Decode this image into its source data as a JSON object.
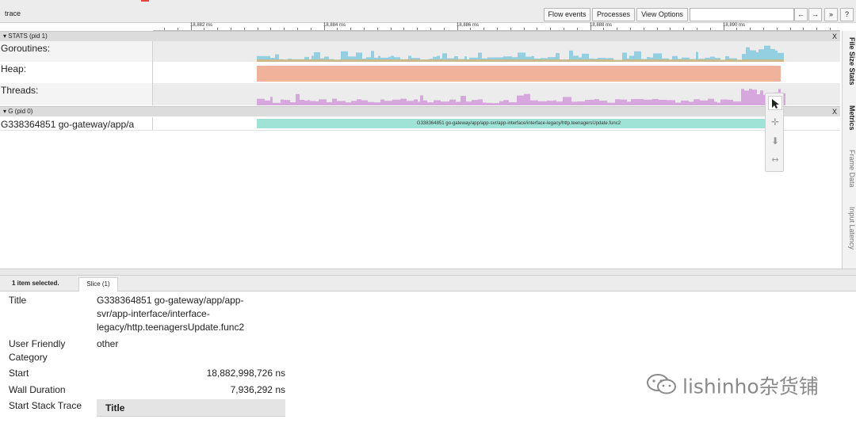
{
  "toolbar": {
    "title": "trace",
    "flow_events": "Flow events",
    "processes": "Processes",
    "view_options": "View Options",
    "search_value": "",
    "prev": "←",
    "next": "→",
    "expand": "»",
    "help": "?"
  },
  "ruler": {
    "labels": [
      "18,882 ms",
      "18,884 ms",
      "18,886 ms",
      "18,888 ms",
      "18,890 ms"
    ]
  },
  "stats_process": {
    "header": "▾ STATS (pid 1)",
    "close": "X",
    "tracks": [
      {
        "label": "Goroutines:"
      },
      {
        "label": "Heap:"
      },
      {
        "label": "Threads:"
      }
    ]
  },
  "g_process": {
    "header": "▾ G (pid 0)",
    "close": "X",
    "thread_label": "G338364851 go-gateway/app/a",
    "slice_title": "G338364851 go-gateway/app/app-svr/app-interface/interface-legacy/http.teenagersUpdate.func2"
  },
  "right_tabs": [
    "File Size Stats",
    "Metrics",
    "Frame Data",
    "Input Latency"
  ],
  "tools": {
    "select": "select-tool",
    "pan": "pan-tool",
    "zoom": "zoom-tool",
    "timing": "timing-tool"
  },
  "panel": {
    "selection_info": "1 item selected.",
    "tab": "Slice (1)",
    "rows": {
      "title_label": "Title",
      "title_value_1": "G338364851 go-gateway/app/app-",
      "title_value_2": "svr/app-interface/interface-",
      "title_value_3": "legacy/http.teenagersUpdate.func2",
      "category_label_1": "User Friendly",
      "category_label_2": "Category",
      "category_value": "other",
      "start_label": "Start",
      "start_value": "18,882,998,726 ns",
      "wall_label": "Wall Duration",
      "wall_value": "7,936,292 ns",
      "stack_label": "Start Stack Trace",
      "stack_col": "Title"
    }
  },
  "watermark": "lishinho杂货铺",
  "colors": {
    "goroutines_a": "#93cfe0",
    "goroutines_b": "#c9b98b",
    "heap": "#f0b29a",
    "threads": "#d6a7dc",
    "slice": "#9ee3d6"
  }
}
